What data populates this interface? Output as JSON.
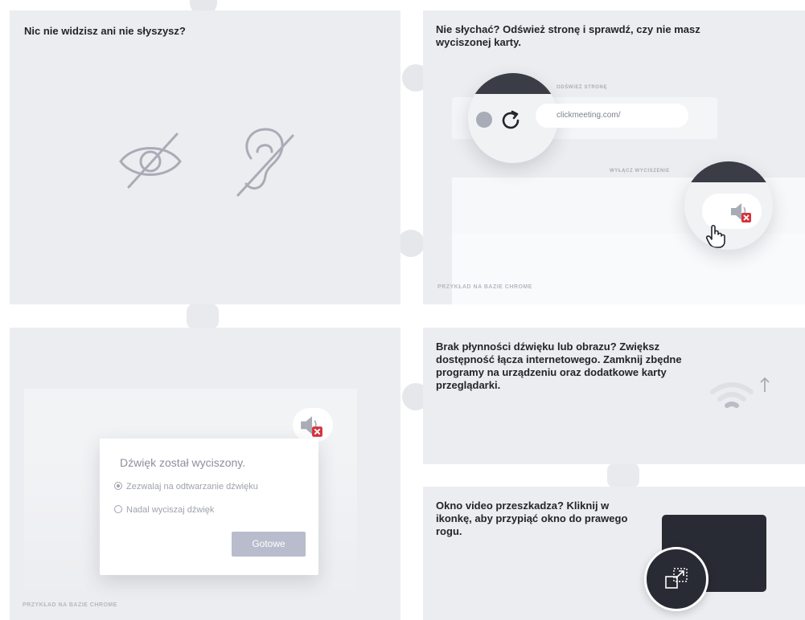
{
  "panels": {
    "no_see_hear": {
      "heading": "Nic nie widzisz ani nie słyszysz?",
      "icons": [
        "eye-slash-icon",
        "ear-slash-icon"
      ]
    },
    "cant_hear": {
      "heading": "Nie słychać? Odśwież stronę i sprawdź, czy nie masz wyciszonej karty.",
      "refresh_label": "ODŚWIEŻ STRONĘ",
      "url_text": "clickmeeting.com/",
      "unmute_label": "WYŁĄCZ WYCISZENIE",
      "caption": "PRZYKŁAD NA BAZIE CHROME",
      "icons": [
        "reload-icon",
        "muted-speaker-icon",
        "hand-pointer-icon"
      ]
    },
    "muted_dialog": {
      "title": "Dźwięk został wyciszony.",
      "options": [
        "Zezwalaj na odtwarzanie dźwięku",
        "Nadal wyciszaj dźwięk"
      ],
      "selected_option": "Zezwalaj na odtwarzanie dźwięku",
      "done_label": "Gotowe",
      "caption": "PRZYKŁAD NA BAZIE CHROME",
      "icons": [
        "muted-speaker-icon"
      ]
    },
    "choppy": {
      "heading": "Brak płynności dźwięku lub obrazu? Zwiększ dostępność łącza internetowego. Zamknij zbędne programy na urządzeniu oraz dodatkowe karty przeglądarki.",
      "icons": [
        "wifi-icon",
        "arrow-up-icon"
      ]
    },
    "video_window": {
      "heading": "Okno video przeszkadza? Kliknij w ikonkę, aby przypiąć okno do prawego rogu.",
      "icons": [
        "pin-to-corner-icon"
      ]
    }
  },
  "colors": {
    "panel_bg": "#ecedf0",
    "icon_gray": "#a8acb6",
    "dark": "#282b34",
    "mute_red": "#d5333c",
    "button_bg": "#b8bccc"
  }
}
